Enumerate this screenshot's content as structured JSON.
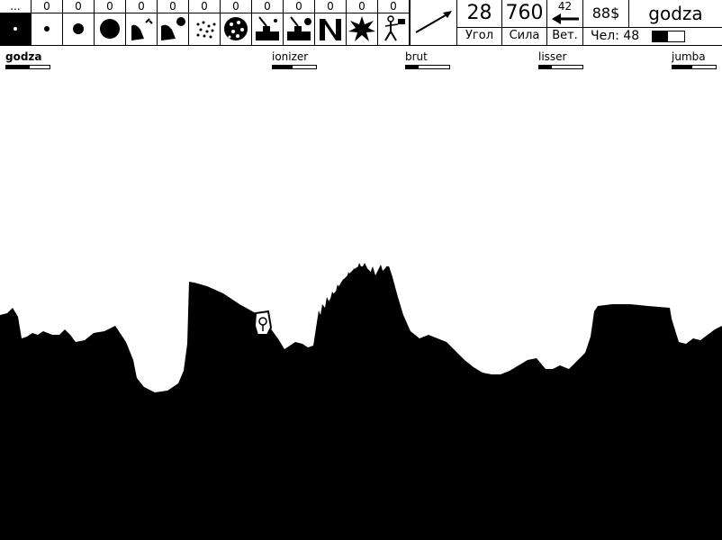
{
  "weapons": [
    {
      "count": "...",
      "icon": "nuke-dot-icon",
      "selected": true
    },
    {
      "count": "0",
      "icon": "small-ball-icon"
    },
    {
      "count": "0",
      "icon": "medium-ball-icon"
    },
    {
      "count": "0",
      "icon": "large-ball-icon"
    },
    {
      "count": "0",
      "icon": "bouncer-icon"
    },
    {
      "count": "0",
      "icon": "big-bouncer-icon"
    },
    {
      "count": "0",
      "icon": "spray-icon"
    },
    {
      "count": "0",
      "icon": "cluster-icon"
    },
    {
      "count": "0",
      "icon": "cannon-icon"
    },
    {
      "count": "0",
      "icon": "cannon-ball-icon"
    },
    {
      "count": "0",
      "icon": "napalm-icon"
    },
    {
      "count": "0",
      "icon": "explosion-icon"
    },
    {
      "count": "0",
      "icon": "walker-icon"
    }
  ],
  "weapon_arrow_icon": "arrow-icon",
  "angle": {
    "value": "28",
    "label": "Угол"
  },
  "power": {
    "value": "760",
    "label": "Сила"
  },
  "wind": {
    "value": "42",
    "label": "Вет.",
    "icon": "wind-arrow-left-icon"
  },
  "money": "88$",
  "current_player": "godza",
  "health": {
    "label": "Чел: 48",
    "value": 48,
    "max": 100
  },
  "players": [
    {
      "name": "godza",
      "hp": 0.55,
      "active": true
    },
    {
      "name": "ionizer",
      "hp": 0.45
    },
    {
      "name": "brut",
      "hp": 0.3
    },
    {
      "name": "lisser",
      "hp": 0.3
    },
    {
      "name": "jumba",
      "hp": 0.45
    }
  ]
}
